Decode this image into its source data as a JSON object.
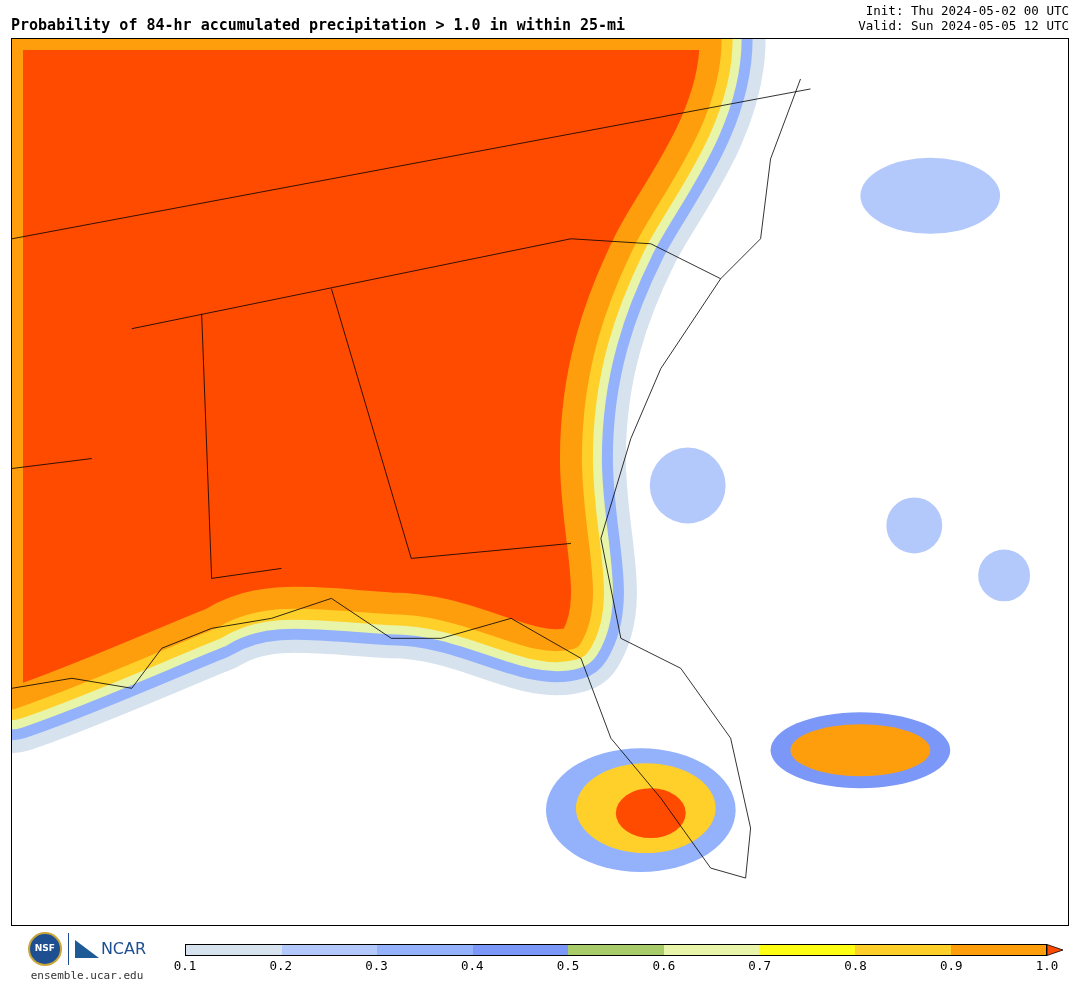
{
  "title": "Probability of 84-hr accumulated precipitation > 1.0 in within 25-mi",
  "init": "Init: Thu 2024-05-02 00 UTC",
  "valid": "Valid: Sun 2024-05-05 12 UTC",
  "logo": {
    "nsf": "NSF",
    "ncar": "NCAR",
    "url": "ensemble.ucar.edu"
  },
  "colorbar": {
    "segments": [
      {
        "color": "#d6e2ee"
      },
      {
        "color": "#b4c9fb"
      },
      {
        "color": "#93b2fb"
      },
      {
        "color": "#7b97f7"
      },
      {
        "color": "#a8cc6a"
      },
      {
        "color": "#e8f5a8"
      },
      {
        "color": "#ffff14"
      },
      {
        "color": "#ffd02a"
      },
      {
        "color": "#ff9e0d"
      }
    ],
    "extension": {
      "kind": "triangle",
      "color": "#ff4b00"
    },
    "ticks": [
      "0.1",
      "0.2",
      "0.3",
      "0.4",
      "0.5",
      "0.6",
      "0.7",
      "0.8",
      "0.9",
      "1.0"
    ]
  }
}
